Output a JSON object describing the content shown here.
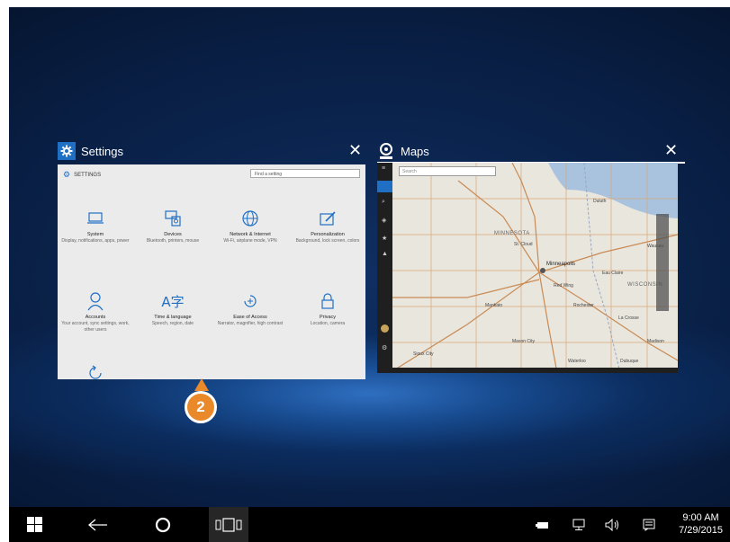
{
  "task_view": {
    "settings": {
      "title": "Settings",
      "close": "✕",
      "header_label": "SETTINGS",
      "search_placeholder": "Find a setting",
      "items": [
        {
          "icon": "laptop-icon",
          "title": "System",
          "desc": "Display, notifications, apps, power"
        },
        {
          "icon": "keyboard-printer-icon",
          "title": "Devices",
          "desc": "Bluetooth, printers, mouse"
        },
        {
          "icon": "globe-icon",
          "title": "Network & Internet",
          "desc": "Wi-Fi, airplane mode, VPN"
        },
        {
          "icon": "paint-icon",
          "title": "Personalization",
          "desc": "Background, lock screen, colors"
        },
        {
          "icon": "person-icon",
          "title": "Accounts",
          "desc": "Your account, sync settings, work, other users"
        },
        {
          "icon": "language-icon",
          "title": "Time & language",
          "desc": "Speech, region, date"
        },
        {
          "icon": "ease-of-access-icon",
          "title": "Ease of Access",
          "desc": "Narrator, magnifier, high contrast"
        },
        {
          "icon": "lock-icon",
          "title": "Privacy",
          "desc": "Location, camera"
        },
        {
          "icon": "update-icon",
          "title": "",
          "desc": ""
        }
      ]
    },
    "maps": {
      "title": "Maps",
      "close": "✕",
      "search_placeholder": "Search",
      "labels": {
        "minnesota": "MINNESOTA",
        "minneapolis": "Minneapolis",
        "wisconsin": "WISCONSIN",
        "st_cloud": "St. Cloud",
        "duluth": "Duluth",
        "rochester": "Rochester",
        "mankato": "Mankato",
        "eau_claire": "Eau Claire",
        "madison": "Madison",
        "dubuque": "Dubuque",
        "waterloo": "Waterloo",
        "mason_city": "Mason City",
        "sioux_city": "Sioux City",
        "wausau": "Wausau",
        "la_crosse": "La Crosse",
        "red_wing": "Red Wing"
      }
    }
  },
  "badge": {
    "number": "2"
  },
  "taskbar": {
    "clock_time": "9:00 AM",
    "clock_date": "7/29/2015"
  }
}
